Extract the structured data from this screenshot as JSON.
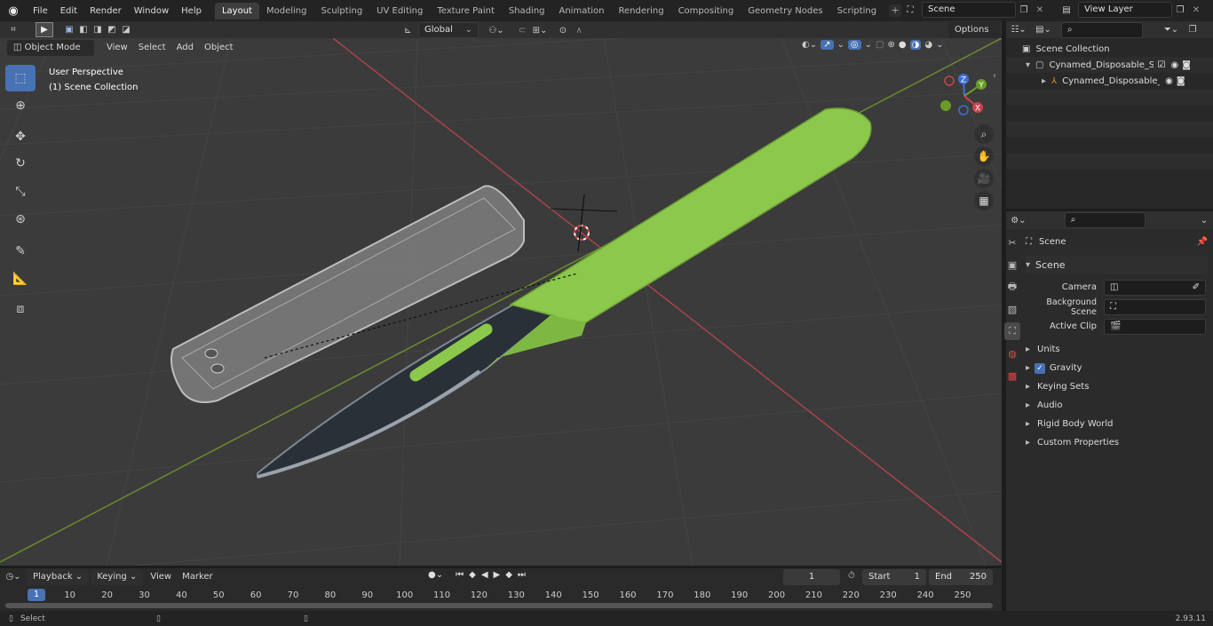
{
  "menu": [
    "File",
    "Edit",
    "Render",
    "Window",
    "Help"
  ],
  "workspace_tabs": [
    {
      "label": "Layout",
      "active": true
    },
    {
      "label": "Modeling"
    },
    {
      "label": "Sculpting"
    },
    {
      "label": "UV Editing"
    },
    {
      "label": "Texture Paint"
    },
    {
      "label": "Shading"
    },
    {
      "label": "Animation"
    },
    {
      "label": "Rendering"
    },
    {
      "label": "Compositing"
    },
    {
      "label": "Geometry Nodes"
    },
    {
      "label": "Scripting"
    }
  ],
  "top_right": {
    "scene": "Scene",
    "view_layer": "View Layer"
  },
  "viewport": {
    "mode": "Object Mode",
    "menu": [
      "View",
      "Select",
      "Add",
      "Object"
    ],
    "orientation": "Global",
    "options_label": "Options",
    "overlay_title": "User Perspective",
    "overlay_sub": "(1) Scene Collection",
    "gizmo_labels": {
      "x": "X",
      "y": "Y",
      "z": "Z"
    }
  },
  "outliner": {
    "search_placeholder": "",
    "root": "Scene Collection",
    "collection": "Cynamed_Disposable_Scalpe",
    "object": "Cynamed_Disposable_Sc"
  },
  "properties": {
    "context": "Scene",
    "panel": "Scene",
    "fields": [
      {
        "label": "Camera",
        "value": ""
      },
      {
        "label": "Background Scene",
        "value": ""
      },
      {
        "label": "Active Clip",
        "value": ""
      }
    ],
    "sections": [
      {
        "label": "Units",
        "checkbox": false
      },
      {
        "label": "Gravity",
        "checkbox": true
      },
      {
        "label": "Keying Sets",
        "checkbox": false
      },
      {
        "label": "Audio",
        "checkbox": false
      },
      {
        "label": "Rigid Body World",
        "checkbox": false
      },
      {
        "label": "Custom Properties",
        "checkbox": false
      }
    ]
  },
  "timeline": {
    "menus": [
      "Playback",
      "Keying",
      "View",
      "Marker"
    ],
    "current_frame": "1",
    "start_label": "Start",
    "start": "1",
    "end_label": "End",
    "end": "250",
    "ruler": [
      "1",
      "10",
      "20",
      "30",
      "40",
      "50",
      "60",
      "70",
      "80",
      "90",
      "100",
      "110",
      "120",
      "130",
      "140",
      "150",
      "160",
      "170",
      "180",
      "190",
      "200",
      "210",
      "220",
      "230",
      "240",
      "250"
    ]
  },
  "status": {
    "left": "Select",
    "version": "2.93.11"
  },
  "colors": {
    "accent": "#4772b3",
    "handle_green": "#8cc84b",
    "x_axis": "#c9434d",
    "y_axis": "#7aa43a"
  }
}
